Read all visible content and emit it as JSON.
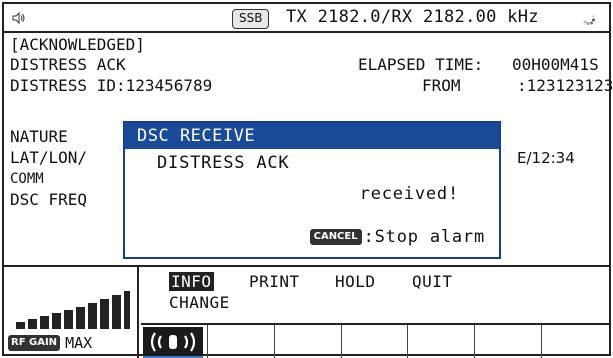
{
  "status": {
    "mode_badge": "SSB",
    "frequency": "TX 2182.0/RX 2182.00 kHz"
  },
  "main": {
    "state": "[ACKNOWLEDGED]",
    "type": "DISTRESS ACK",
    "elapsed_label": "ELAPSED TIME:",
    "elapsed_value": "00H00M41S",
    "distress_id": "DISTRESS ID:123456789",
    "from_label": "FROM",
    "from_value": ":123123123",
    "nature": "NATURE",
    "latlon": "LAT/LON/",
    "time_value": "E/12:34",
    "comm": "COMM",
    "dsc_freq": "DSC FREQ"
  },
  "popup": {
    "title": "DSC RECEIVE",
    "line1": "DISTRESS ACK",
    "line2": "received!",
    "cancel_key": "CANCEL",
    "cancel_action": ":Stop alarm"
  },
  "left_panel": {
    "rf_gain_key": "RF GAIN",
    "gain_level": "MAX",
    "gain_bars": 10
  },
  "menu": {
    "items": [
      "INFO",
      "PRINT",
      "HOLD",
      "QUIT"
    ],
    "change": "CHANGE"
  },
  "colors": {
    "popup_title_bg": "#1a4a9a",
    "active_key_underline": "#3a78c9"
  }
}
